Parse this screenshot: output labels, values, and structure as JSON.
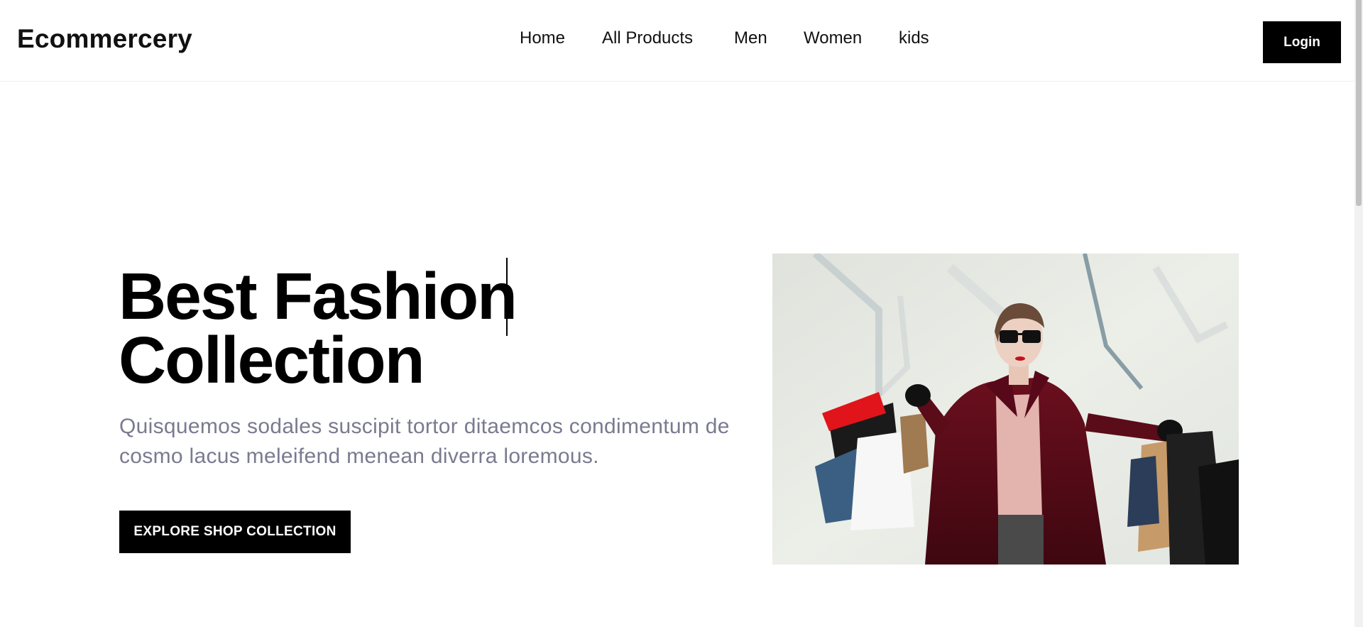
{
  "header": {
    "brand": "Ecommercery",
    "nav": [
      {
        "label": "Home"
      },
      {
        "label": "All Products"
      },
      {
        "label": "Men"
      },
      {
        "label": "Women"
      },
      {
        "label": "kids"
      }
    ],
    "login_label": "Login"
  },
  "hero": {
    "title_line1": "Best Fashion",
    "title_line2": "Collection",
    "subtitle": "Quisquemos sodales suscipit tortor ditaemcos condimentum de cosmo lacus meleifend menean diverra loremous.",
    "cta_label": "EXPLORE SHOP COLLECTION"
  },
  "colors": {
    "accent": "#000000",
    "subtitle": "#7a7a90",
    "background": "#ffffff"
  }
}
